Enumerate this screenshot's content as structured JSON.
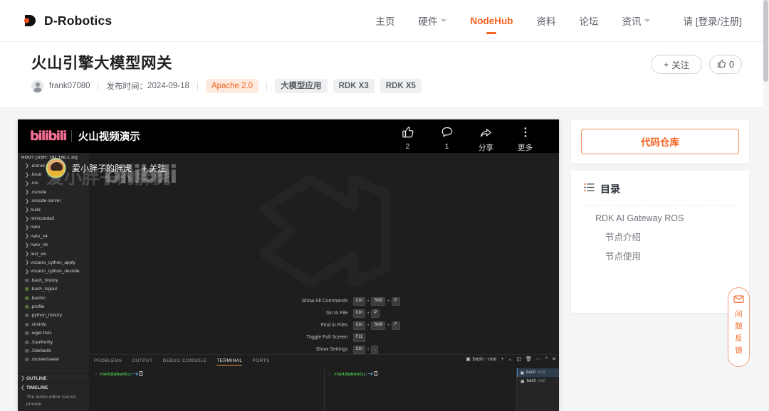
{
  "navbar": {
    "brand": "D-Robotics",
    "links": [
      {
        "label": "主页",
        "has_caret": false,
        "active": false
      },
      {
        "label": "硬件",
        "has_caret": true,
        "active": false
      },
      {
        "label": "NodeHub",
        "has_caret": false,
        "active": true
      },
      {
        "label": "资料",
        "has_caret": false,
        "active": false
      },
      {
        "label": "论坛",
        "has_caret": false,
        "active": false
      },
      {
        "label": "资讯",
        "has_caret": true,
        "active": false
      }
    ],
    "login": "请 [登录/注册]"
  },
  "header": {
    "title": "火山引擎大模型网关",
    "author": "frank07080",
    "publish_label": "发布时间：",
    "publish_date": "2024-09-18",
    "license": "Apache 2.0",
    "tags": [
      "大模型应用",
      "RDK X3",
      "RDK X5"
    ],
    "follow_button": "关注",
    "follow_plus": "+",
    "like_count": "0"
  },
  "video": {
    "platform_logo": "bilibili",
    "title": "火山视频演示",
    "uploader": "爱小胖子的胖虎",
    "uploader_follow": "+ 关注",
    "watermark": "bilibili",
    "actions": [
      {
        "icon": "thumbs-up-icon",
        "label": "2"
      },
      {
        "icon": "comment-icon",
        "label": "1"
      },
      {
        "icon": "share-icon",
        "label": "分享"
      },
      {
        "icon": "more-icon",
        "label": "更多"
      }
    ]
  },
  "vscode": {
    "explorer_root": "ROOT [SSH: 192.168.1.10]",
    "folders": [
      ".dotnet",
      ".local",
      ".ros",
      ".vscode",
      ".vscode-server",
      "build",
      "miniconda3",
      "rwkv",
      "rwkv_v4",
      "rwkv_v6",
      "test_ws",
      "vocano_cython_apply",
      "vocano_cython_decode"
    ],
    "files": [
      {
        "name": ".bash_history",
        "kind": "file"
      },
      {
        "name": ".bash_logout",
        "kind": "script"
      },
      {
        "name": ".bashrc",
        "kind": "script"
      },
      {
        "name": ".profile",
        "kind": "script"
      },
      {
        "name": ".python_history",
        "kind": "file"
      },
      {
        "name": ".viminfo",
        "kind": "file"
      },
      {
        "name": ".wget-hsts",
        "kind": "file"
      },
      {
        "name": ".Xauthority",
        "kind": "file"
      },
      {
        "name": ".Xdefaults",
        "kind": "file"
      },
      {
        "name": ".xscreensaver",
        "kind": "file"
      }
    ],
    "outline_label": "OUTLINE",
    "timeline_label": "TIMELINE",
    "timeline_body": "The active editor cannot provide",
    "shortcuts": [
      {
        "label": "Show All Commands",
        "keys": [
          "Ctrl",
          "Shift",
          "P"
        ]
      },
      {
        "label": "Go to File",
        "keys": [
          "Ctrl",
          "P"
        ]
      },
      {
        "label": "Find in Files",
        "keys": [
          "Ctrl",
          "Shift",
          "F"
        ]
      },
      {
        "label": "Toggle Full Screen",
        "keys": [
          "F11"
        ]
      },
      {
        "label": "Show Settings",
        "keys": [
          "Ctrl",
          ","
        ]
      }
    ],
    "panel_tabs": [
      {
        "label": "PROBLEMS",
        "active": false
      },
      {
        "label": "OUTPUT",
        "active": false
      },
      {
        "label": "DEBUG CONSOLE",
        "active": false
      },
      {
        "label": "TERMINAL",
        "active": true
      },
      {
        "label": "PORTS",
        "active": false
      }
    ],
    "terminal_selector": "bash - root",
    "terminal_prompt_user": "root",
    "terminal_prompt_at": "@",
    "terminal_prompt_host": "ubuntu",
    "terminal_prompt_path": ":~#",
    "terminal_instances": [
      {
        "name": "bash",
        "sub": "root"
      },
      {
        "name": "bash",
        "sub": "root"
      }
    ]
  },
  "sidebar": {
    "repo_button": "代码仓库",
    "toc_title": "目录",
    "toc_items": [
      {
        "label": "RDK AI Gateway ROS",
        "level": 1
      },
      {
        "label": "节点介绍",
        "level": 2
      },
      {
        "label": "节点使用",
        "level": 2
      }
    ]
  },
  "feedback": {
    "icon": "envelope-icon",
    "lines": [
      "问",
      "题",
      "反",
      "馈"
    ]
  },
  "colors": {
    "accent": "#f4631f",
    "page_bg": "#f4f5f7",
    "card_bg": "#ffffff",
    "text": "#333333",
    "muted": "#6b7079",
    "bili_pink": "#fb7299"
  }
}
